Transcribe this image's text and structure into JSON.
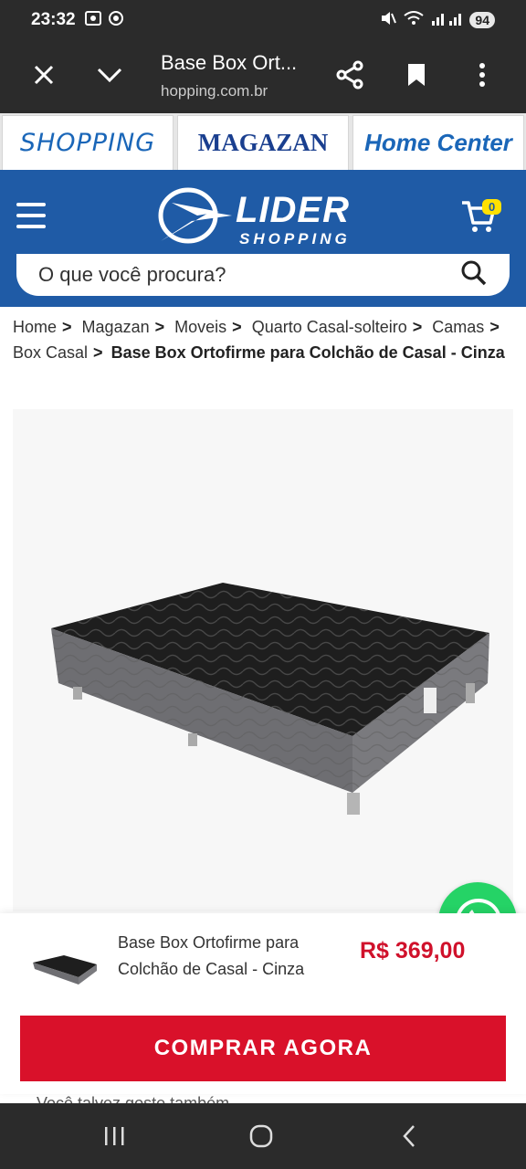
{
  "status_bar": {
    "time": "23:32",
    "battery": "94"
  },
  "browser": {
    "tab_title": "Base Box Ort...",
    "domain": "hopping.com.br",
    "icons": [
      "close-icon",
      "chevron-down-icon",
      "share-icon",
      "bookmark-icon",
      "more-vert-icon"
    ]
  },
  "brand_tabs": [
    "SHOPPING",
    "MAGAZAN",
    "Home Center"
  ],
  "header": {
    "logo_word": "LIDER",
    "logo_sub": "SHOPPING",
    "cart_count": "0",
    "search_placeholder": "O que você procura?",
    "bg_color": "#1f5ba6"
  },
  "breadcrumb": {
    "items": [
      "Home",
      "Magazan",
      "Moveis",
      "Quarto Casal-solteiro",
      "Camas",
      "Box Casal"
    ],
    "current": "Base Box Ortofirme para Colchão de Casal - Cinza"
  },
  "sticky_bar": {
    "product_name": "Base Box Ortofirme para Colchão de Casal - Cinza",
    "price": "R$ 369,00",
    "buy_label": "COMPRAR AGORA",
    "buy_color": "#d9112a",
    "price_color": "#d0112b"
  },
  "peek_text": "Você talvez goste também",
  "whatsapp_color": "#25d366"
}
